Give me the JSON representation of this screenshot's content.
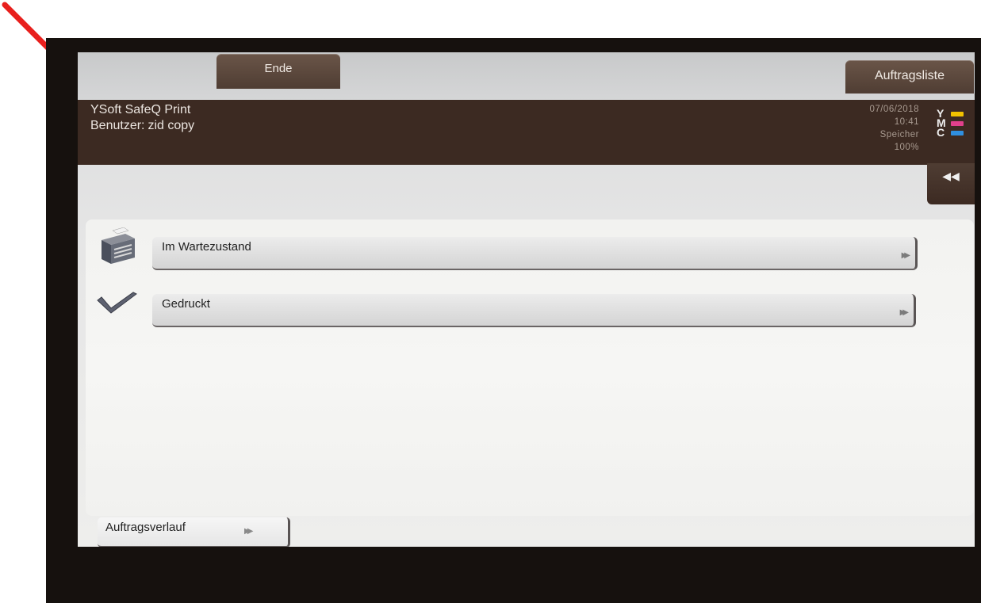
{
  "topbar": {
    "end_label": "Ende",
    "jobs_label": "Auftragsliste"
  },
  "header": {
    "app_name": "YSoft SafeQ Print",
    "user_prefix": "Benutzer:",
    "user_name": "zid copy"
  },
  "status": {
    "date": "07/06/2018",
    "time": "10:41",
    "memory_label": "Speicher",
    "memory_value": "100%"
  },
  "toner": [
    {
      "letter": "Y",
      "color": "#f2c200"
    },
    {
      "letter": "M",
      "color": "#e0408c"
    },
    {
      "letter": "C",
      "color": "#2f8fe0"
    }
  ],
  "side_tab": {
    "icon": "double-chevron-left-icon",
    "glyph": "◀◀"
  },
  "list": {
    "items": [
      {
        "label": "Im Wartezustand",
        "icon": "printer-icon",
        "chevron": "▶▶"
      },
      {
        "label": "Gedruckt",
        "icon": "checkmark-icon",
        "chevron": "▶▶"
      }
    ]
  },
  "history": {
    "label": "Auftragsverlauf",
    "chevron": "▶▶"
  },
  "colors": {
    "accent_brown": "#3c2a22",
    "arrow_red": "#e8201d"
  }
}
